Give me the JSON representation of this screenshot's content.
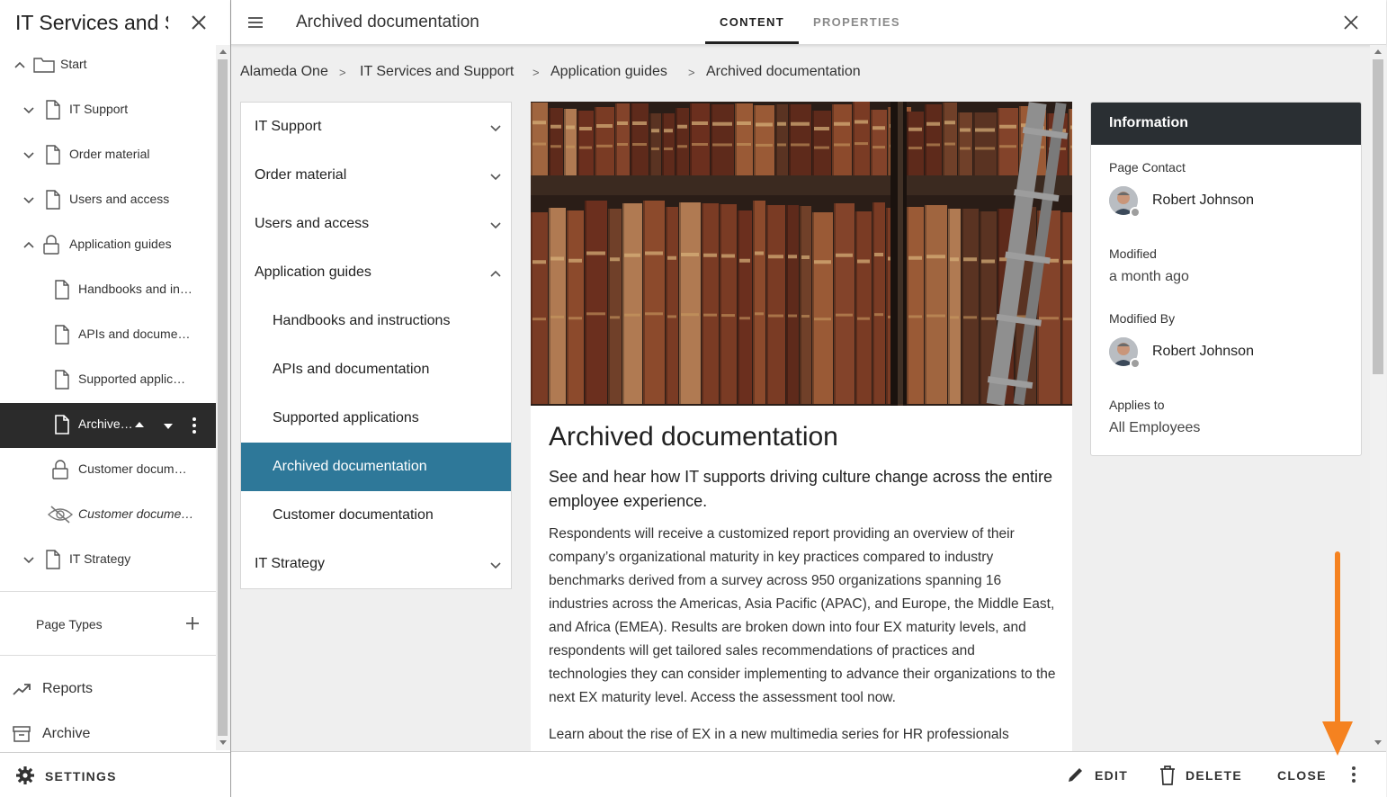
{
  "sidebar": {
    "title": "IT Services and Support",
    "tree": [
      {
        "label": "Start",
        "icon": "folder-icon",
        "chevron": "up"
      },
      {
        "label": "IT Support",
        "icon": "page-icon",
        "chevron": "down"
      },
      {
        "label": "Order material",
        "icon": "page-icon",
        "chevron": "down"
      },
      {
        "label": "Users and access",
        "icon": "page-icon",
        "chevron": "down"
      },
      {
        "label": "Application guides",
        "icon": "lock-icon",
        "chevron": "up"
      },
      {
        "label": "Handbooks and in…",
        "icon": "page-icon"
      },
      {
        "label": "APIs and docume…",
        "icon": "page-icon"
      },
      {
        "label": "Supported applic…",
        "icon": "page-icon"
      },
      {
        "label": "Archive…",
        "icon": "page-icon",
        "active": true
      },
      {
        "label": "Customer docum…",
        "icon": "lock-icon"
      },
      {
        "label": "Customer docume…",
        "icon": "hidden-icon",
        "italic": true
      },
      {
        "label": "IT Strategy",
        "icon": "page-icon",
        "chevron": "down"
      }
    ],
    "page_types_label": "Page Types",
    "reports_label": "Reports",
    "archive_label": "Archive",
    "settings_label": "SETTINGS"
  },
  "header": {
    "title": "Archived documentation",
    "tabs": [
      {
        "label": "CONTENT",
        "active": true
      },
      {
        "label": "PROPERTIES",
        "active": false
      }
    ]
  },
  "breadcrumb": {
    "items": [
      "Alameda One",
      "IT Services and Support",
      "Application guides",
      "Archived documentation"
    ],
    "separator": ">"
  },
  "nav": {
    "items": [
      {
        "label": "IT Support",
        "chevron": "down"
      },
      {
        "label": "Order material",
        "chevron": "down"
      },
      {
        "label": "Users and access",
        "chevron": "down"
      },
      {
        "label": "Application guides",
        "chevron": "up"
      },
      {
        "label": "Handbooks and instructions"
      },
      {
        "label": "APIs and documentation"
      },
      {
        "label": "Supported applications"
      },
      {
        "label": "Archived documentation",
        "active": true
      },
      {
        "label": "Customer documentation"
      },
      {
        "label": "IT Strategy",
        "chevron": "down"
      }
    ],
    "active_color": "#2e7899"
  },
  "article": {
    "title": "Archived documentation",
    "lead": "See and hear how IT supports driving culture change across the entire employee experience.",
    "body": "Respondents will receive a customized report providing an overview of their company’s organizational maturity in key practices compared to industry benchmarks derived from a survey across 950 organizations spanning 16 industries across the Americas, Asia Pacific (APAC), and Europe, the Middle East, and Africa (EMEA). Results are broken down into four EX maturity levels, and respondents will get tailored sales recommendations of practices and technologies they can consider implementing to advance their organizations to the next EX maturity level. Access the assessment tool now.",
    "body2": "Learn about the rise of EX in a new multimedia series for HR professionals"
  },
  "info": {
    "heading": "Information",
    "page_contact_label": "Page Contact",
    "page_contact_name": "Robert Johnson",
    "modified_label": "Modified",
    "modified_value": "a month ago",
    "modified_by_label": "Modified By",
    "modified_by_name": "Robert Johnson",
    "applies_to_label": "Applies to",
    "applies_to_value": "All Employees"
  },
  "actions": {
    "edit": "EDIT",
    "delete": "DELETE",
    "close": "CLOSE"
  },
  "colors": {
    "sidebar_active_bg": "#2b2b2b",
    "info_header_bg": "#2a2f33",
    "annotation_arrow": "#f58220"
  }
}
